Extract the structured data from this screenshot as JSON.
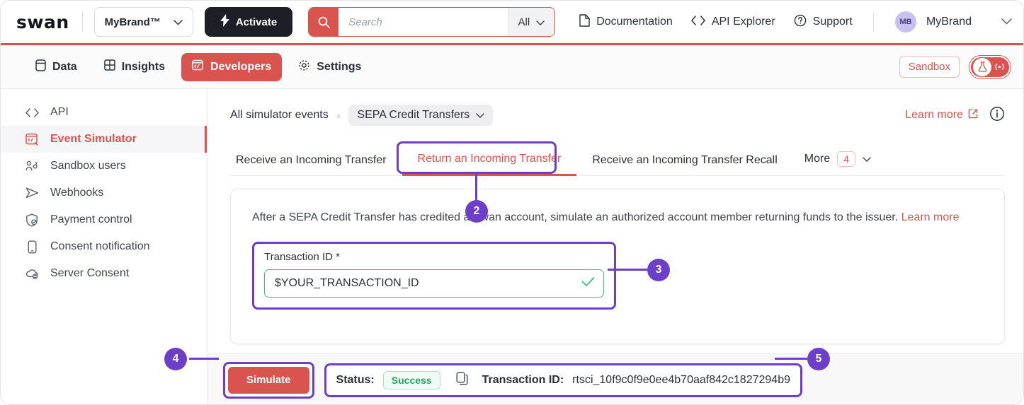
{
  "header": {
    "logo": "swan",
    "brand_select": {
      "label": "MyBrand™",
      "icon": "chevron-down-icon"
    },
    "activate_button": {
      "label": "Activate",
      "icon": "bolt-icon"
    },
    "search": {
      "placeholder": "Search",
      "value": "",
      "scope": "All",
      "icon": "search-icon"
    },
    "links": [
      {
        "label": "Documentation",
        "icon": "document-icon"
      },
      {
        "label": "API Explorer",
        "icon": "code-icon"
      },
      {
        "label": "Support",
        "icon": "question-circle-icon"
      }
    ],
    "account": {
      "initials": "MB",
      "name": "MyBrand",
      "icon": "chevron-down-icon"
    }
  },
  "nav": {
    "items": [
      {
        "label": "Data",
        "icon": "database-icon",
        "active": false
      },
      {
        "label": "Insights",
        "icon": "grid-icon",
        "active": false
      },
      {
        "label": "Developers",
        "icon": "terminal-icon",
        "active": true
      },
      {
        "label": "Settings",
        "icon": "gear-icon",
        "active": false
      }
    ],
    "sandbox_chip": "Sandbox",
    "env_toggle": {
      "icon": "flask-icon",
      "secondary_icon": "broadcast-icon",
      "state": "sandbox"
    }
  },
  "sidebar": {
    "items": [
      {
        "label": "API",
        "icon": "code-icon",
        "active": false
      },
      {
        "label": "Event Simulator",
        "icon": "event-simulator-icon",
        "active": true
      },
      {
        "label": "Sandbox users",
        "icon": "users-icon",
        "active": false
      },
      {
        "label": "Webhooks",
        "icon": "send-icon",
        "active": false
      },
      {
        "label": "Payment control",
        "icon": "shield-check-icon",
        "active": false
      },
      {
        "label": "Consent notification",
        "icon": "mobile-icon",
        "active": false
      },
      {
        "label": "Server Consent",
        "icon": "cloud-sync-icon",
        "active": false
      }
    ]
  },
  "breadcrumb": {
    "root": "All simulator events",
    "separator": "›",
    "current": "SEPA Credit Transfers",
    "current_icon": "chevron-down-icon",
    "learn_more": "Learn more",
    "learn_more_icon": "external-link-icon",
    "info_icon": "info-circle-icon"
  },
  "tabs": {
    "items": [
      {
        "label": "Receive an Incoming Transfer",
        "active": false
      },
      {
        "label": "Return an Incoming Transfer",
        "active": true
      },
      {
        "label": "Receive an Incoming Transfer Recall",
        "active": false
      }
    ],
    "more_label": "More",
    "more_count": "4",
    "more_icon": "chevron-down-icon"
  },
  "card": {
    "description_before": "After a SEPA Credit Transfer has credited a Swan account, simulate an authorized account member returning funds to the issuer.",
    "description_link": "Learn more",
    "field": {
      "label": "Transaction ID *",
      "value": "$YOUR_TRANSACTION_ID",
      "placeholder": "$YOUR_TRANSACTION_ID",
      "valid_icon": "check-icon"
    }
  },
  "bottom": {
    "simulate_button": "Simulate",
    "status_label": "Status:",
    "status_value": "Success",
    "copy_icon": "copy-icon",
    "transaction_label": "Transaction ID:",
    "transaction_value": "rtsci_10f9c0f9e0ee4b70aaf842c1827294b9"
  },
  "annotations": [
    {
      "number": "2"
    },
    {
      "number": "3"
    },
    {
      "number": "4"
    },
    {
      "number": "5"
    }
  ],
  "colors": {
    "accent_red": "#d9534f",
    "annotation_purple": "#6d3fc8",
    "success_green": "#2aa36a",
    "dark": "#1c2026"
  }
}
